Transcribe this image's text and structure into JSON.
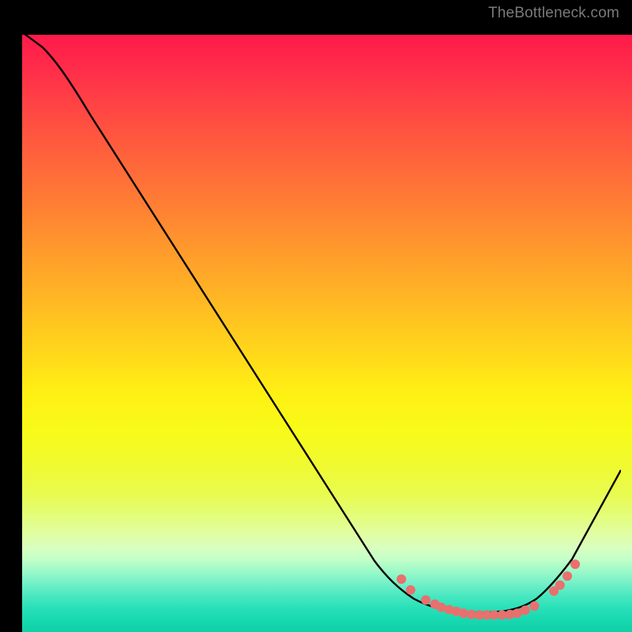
{
  "watermark": "TheBottleneck.com",
  "chart_data": {
    "type": "line",
    "title": "",
    "xlabel": "",
    "ylabel": "",
    "xlim": [
      0,
      1
    ],
    "ylim": [
      0,
      1
    ],
    "series": [
      {
        "name": "curve",
        "x": [
          0.0,
          0.03,
          0.06,
          0.1,
          0.15,
          0.2,
          0.25,
          0.3,
          0.35,
          0.4,
          0.45,
          0.5,
          0.55,
          0.6,
          0.64,
          0.66,
          0.68,
          0.7,
          0.72,
          0.74,
          0.76,
          0.78,
          0.8,
          0.82,
          0.84,
          0.86,
          0.88,
          0.9,
          0.92,
          0.94,
          0.96,
          0.98,
          1.0
        ],
        "y": [
          1.0,
          0.99,
          0.97,
          0.93,
          0.85,
          0.77,
          0.69,
          0.61,
          0.53,
          0.45,
          0.37,
          0.29,
          0.21,
          0.13,
          0.07,
          0.05,
          0.035,
          0.025,
          0.018,
          0.013,
          0.01,
          0.01,
          0.01,
          0.01,
          0.012,
          0.018,
          0.03,
          0.05,
          0.08,
          0.12,
          0.17,
          0.22,
          0.27
        ]
      }
    ],
    "markers": [
      {
        "x": 0.64,
        "y": 0.07
      },
      {
        "x": 0.655,
        "y": 0.052
      },
      {
        "x": 0.68,
        "y": 0.035
      },
      {
        "x": 0.695,
        "y": 0.028
      },
      {
        "x": 0.705,
        "y": 0.023
      },
      {
        "x": 0.718,
        "y": 0.019
      },
      {
        "x": 0.73,
        "y": 0.016
      },
      {
        "x": 0.742,
        "y": 0.013
      },
      {
        "x": 0.755,
        "y": 0.011
      },
      {
        "x": 0.768,
        "y": 0.01
      },
      {
        "x": 0.78,
        "y": 0.01
      },
      {
        "x": 0.792,
        "y": 0.01
      },
      {
        "x": 0.805,
        "y": 0.01
      },
      {
        "x": 0.818,
        "y": 0.011
      },
      {
        "x": 0.83,
        "y": 0.013
      },
      {
        "x": 0.843,
        "y": 0.018
      },
      {
        "x": 0.858,
        "y": 0.025
      },
      {
        "x": 0.89,
        "y": 0.05
      },
      {
        "x": 0.9,
        "y": 0.06
      },
      {
        "x": 0.912,
        "y": 0.075
      },
      {
        "x": 0.925,
        "y": 0.095
      }
    ],
    "colors": {
      "curve_stroke": "#000000",
      "marker_fill": "#e8706e",
      "gradient_top": "#ff1a4a",
      "gradient_mid": "#ffe020",
      "gradient_bottom": "#10d0a8"
    }
  }
}
